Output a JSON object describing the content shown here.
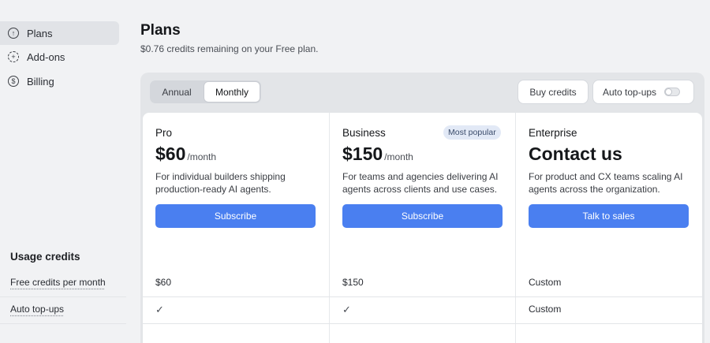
{
  "sidebar": {
    "items": [
      {
        "label": "Plans",
        "icon": "arrow-up-circle-icon",
        "active": true
      },
      {
        "label": "Add-ons",
        "icon": "plus-dashed-circle-icon",
        "active": false
      },
      {
        "label": "Billing",
        "icon": "dollar-circle-icon",
        "active": false
      }
    ],
    "usage_title": "Usage credits",
    "rows": [
      "Free credits per month",
      "Auto top-ups"
    ]
  },
  "header": {
    "title": "Plans",
    "subtitle": "$0.76 credits remaining on your Free plan."
  },
  "toolbar": {
    "periods": [
      "Annual",
      "Monthly"
    ],
    "selected_period": "Monthly",
    "buy_credits_label": "Buy credits",
    "auto_topups_label": "Auto top-ups",
    "auto_topups_enabled": false
  },
  "plans": [
    {
      "name": "Pro",
      "price": "$60",
      "per": "/month",
      "description": "For individual builders shipping production-ready AI agents.",
      "cta": "Subscribe",
      "free_credits": "$60",
      "auto_topups": "✓"
    },
    {
      "name": "Business",
      "badge": "Most popular",
      "price": "$150",
      "per": "/month",
      "description": "For teams and agencies delivering AI agents across clients and use cases.",
      "cta": "Subscribe",
      "free_credits": "$150",
      "auto_topups": "✓"
    },
    {
      "name": "Enterprise",
      "price": "Contact us",
      "per": "",
      "description": "For product and CX teams scaling AI agents across the organization.",
      "cta": "Talk to sales",
      "free_credits": "Custom",
      "auto_topups": "Custom"
    }
  ],
  "colors": {
    "accent": "#4a7ff0",
    "background": "#f1f2f4",
    "badge_bg": "#e2e9f6"
  }
}
